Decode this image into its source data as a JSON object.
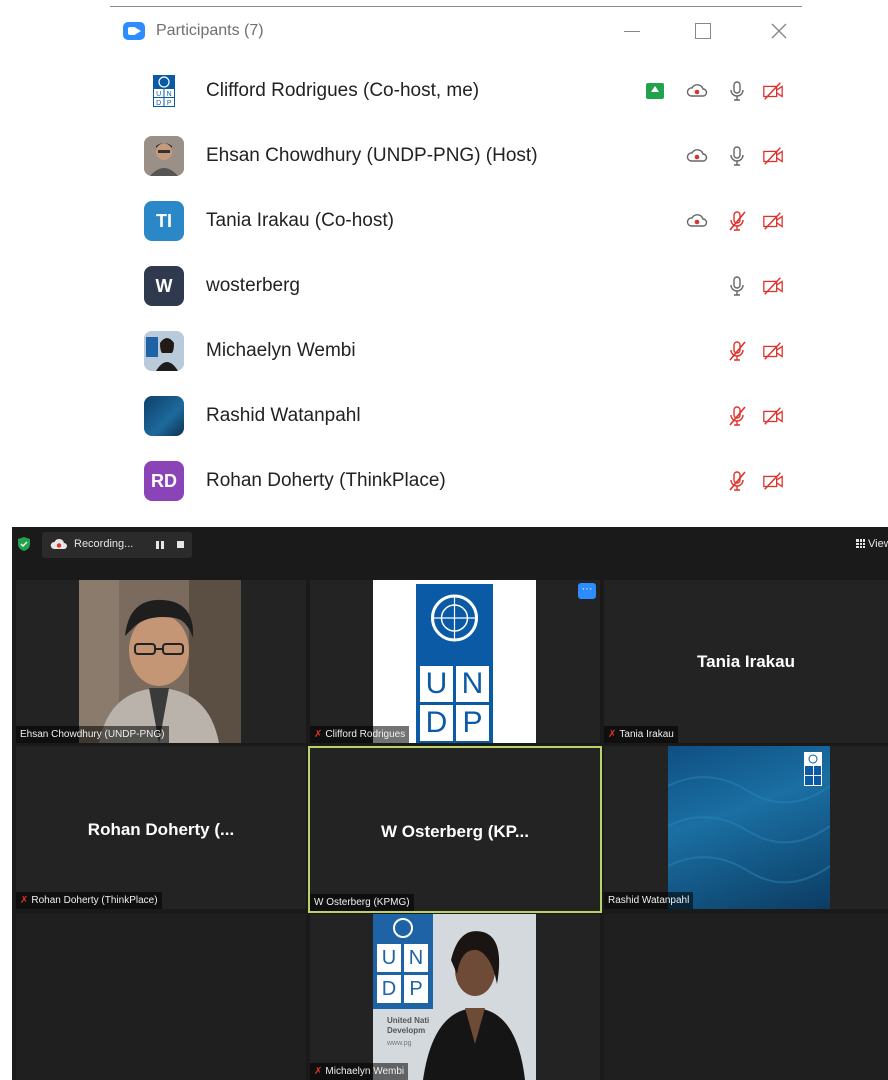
{
  "panel": {
    "title": "Participants (7)",
    "participants": [
      {
        "name": "Clifford Rodrigues (Co-host, me)",
        "initials": "",
        "avatar_color": "#0a5aa5"
      },
      {
        "name": "Ehsan  Chowdhury (UNDP-PNG) (Host)",
        "initials": "",
        "avatar_color": "#6a6a6a"
      },
      {
        "name": "Tania Irakau (Co-host)",
        "initials": "TI",
        "avatar_color": "#2a87c8"
      },
      {
        "name": "wosterberg",
        "initials": "W",
        "avatar_color": "#2f3a4f"
      },
      {
        "name": "Michaelyn Wembi",
        "initials": "",
        "avatar_color": "#8aa7c6"
      },
      {
        "name": "Rashid Watanpahl",
        "initials": "",
        "avatar_color": "#124a78"
      },
      {
        "name": "Rohan Doherty (ThinkPlace)",
        "initials": "RD",
        "avatar_color": "#8a44b8"
      }
    ]
  },
  "meeting": {
    "recording_label": "Recording...",
    "view_label": "View",
    "tiles": [
      {
        "label": "Ehsan  Chowdhury (UNDP-PNG)",
        "center": ""
      },
      {
        "label": "Clifford Rodrigues",
        "center": ""
      },
      {
        "label": "Tania Irakau",
        "center": "Tania Irakau"
      },
      {
        "label": "Rohan Doherty (ThinkPlace)",
        "center": "Rohan Doherty (..."
      },
      {
        "label": "W Osterberg (KPMG)",
        "center": "W Osterberg (KP..."
      },
      {
        "label": "Rashid Watanpahl",
        "center": ""
      },
      {
        "label": "Michaelyn Wembi",
        "center": ""
      }
    ],
    "logo_letters": [
      "U",
      "N",
      "D",
      "P"
    ],
    "banner_text_1": "United Nati",
    "banner_text_2": "Developm",
    "banner_text_3": "www.pg"
  },
  "colors": {
    "accent": "#2D8CFF",
    "muted_red": "#e0302b",
    "active_speaker_border": "#b9d36b",
    "share_green": "#23a24d"
  }
}
